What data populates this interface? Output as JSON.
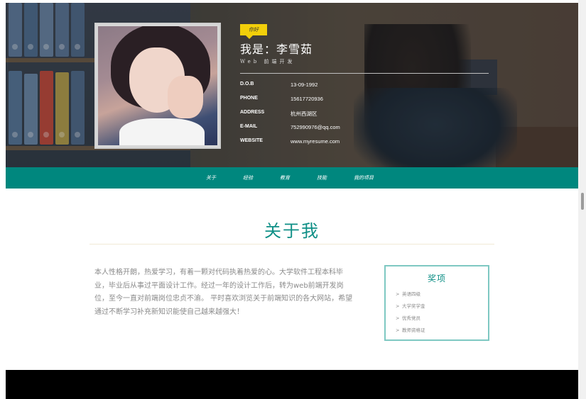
{
  "header": {
    "tag": "你好",
    "name": "我是：李雪茹",
    "subtitle": "Web 前端开发",
    "info": [
      {
        "label": "D.O.B",
        "value": "13-09-1992"
      },
      {
        "label": "PHONE",
        "value": "15617720936"
      },
      {
        "label": "ADDRESS",
        "value": "杭州西湖区"
      },
      {
        "label": "E-MAIL",
        "value": "752990976@qq.com"
      },
      {
        "label": "WEBSITE",
        "value": "www.myresume.com"
      }
    ]
  },
  "nav": {
    "items": [
      "关于",
      "经验",
      "教育",
      "技能",
      "我的项目"
    ]
  },
  "about": {
    "title": "关于我",
    "text": "本人性格开朗，热爱学习，有着一颗对代码执着热爱的心。大学软件工程本科毕业，毕业后从事过平面设计工作。经过一年的设计工作后，转为web前端开发岗位，至今一直对前端岗位忠贞不渝。 平时喜欢浏览关于前端知识的各大网站，希望通过不断学习补充新知识能使自己越来越强大！"
  },
  "awards": {
    "title": "奖项",
    "arrow": ">",
    "items": [
      "英语四级",
      "大学奖学金",
      "优秀党员",
      "教师资格证"
    ]
  },
  "colors": {
    "accent": "#00877e",
    "title": "#0e8f86",
    "tag": "#f2cf0a",
    "footer": "#000000"
  }
}
